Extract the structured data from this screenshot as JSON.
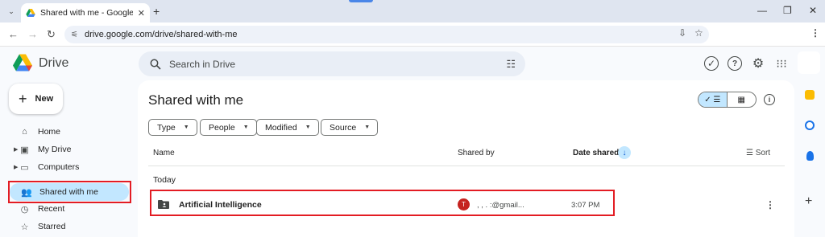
{
  "browser": {
    "tab_title": "Shared with me - Google Drive",
    "url": "drive.google.com/drive/shared-with-me"
  },
  "drive": {
    "product_name": "Drive",
    "search_placeholder": "Search in Drive"
  },
  "nav": {
    "new_label": "New",
    "items": [
      {
        "label": "Home",
        "icon": "home-icon"
      },
      {
        "label": "My Drive",
        "icon": "my-drive-icon"
      },
      {
        "label": "Computers",
        "icon": "computers-icon"
      },
      {
        "label": "Shared with me",
        "icon": "shared-icon",
        "active": true
      },
      {
        "label": "Recent",
        "icon": "clock-icon"
      },
      {
        "label": "Starred",
        "icon": "star-icon"
      }
    ]
  },
  "main": {
    "title": "Shared with me",
    "filters": [
      "Type",
      "People",
      "Modified",
      "Source"
    ],
    "columns": {
      "name": "Name",
      "shared_by": "Shared by",
      "date_shared": "Date shared",
      "sort": "Sort"
    },
    "group": "Today",
    "rows": [
      {
        "name": "Artificial Intelligence",
        "avatar_letter": "T",
        "shared_by": ", ,        .        :@gmail...",
        "date_shared": "3:07 PM"
      }
    ]
  },
  "colors": {
    "active_nav": "#c2e7ff",
    "highlight_box": "#e31c23",
    "avatar": "#c5221f"
  }
}
